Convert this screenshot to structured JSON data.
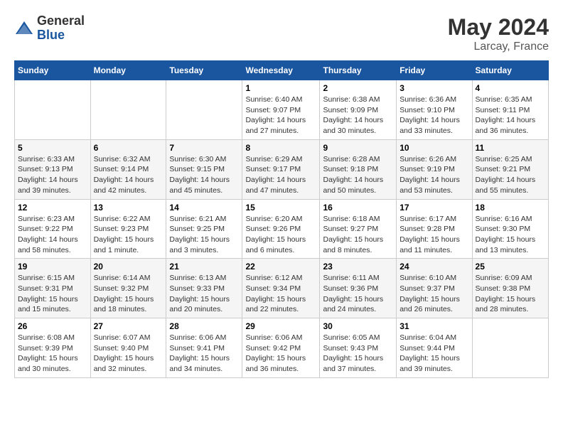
{
  "header": {
    "logo": {
      "general": "General",
      "blue": "Blue"
    },
    "title": "May 2024",
    "location": "Larcay, France"
  },
  "days_of_week": [
    "Sunday",
    "Monday",
    "Tuesday",
    "Wednesday",
    "Thursday",
    "Friday",
    "Saturday"
  ],
  "weeks": [
    [
      {
        "day": "",
        "info": ""
      },
      {
        "day": "",
        "info": ""
      },
      {
        "day": "",
        "info": ""
      },
      {
        "day": "1",
        "info": "Sunrise: 6:40 AM\nSunset: 9:07 PM\nDaylight: 14 hours\nand 27 minutes."
      },
      {
        "day": "2",
        "info": "Sunrise: 6:38 AM\nSunset: 9:09 PM\nDaylight: 14 hours\nand 30 minutes."
      },
      {
        "day": "3",
        "info": "Sunrise: 6:36 AM\nSunset: 9:10 PM\nDaylight: 14 hours\nand 33 minutes."
      },
      {
        "day": "4",
        "info": "Sunrise: 6:35 AM\nSunset: 9:11 PM\nDaylight: 14 hours\nand 36 minutes."
      }
    ],
    [
      {
        "day": "5",
        "info": "Sunrise: 6:33 AM\nSunset: 9:13 PM\nDaylight: 14 hours\nand 39 minutes."
      },
      {
        "day": "6",
        "info": "Sunrise: 6:32 AM\nSunset: 9:14 PM\nDaylight: 14 hours\nand 42 minutes."
      },
      {
        "day": "7",
        "info": "Sunrise: 6:30 AM\nSunset: 9:15 PM\nDaylight: 14 hours\nand 45 minutes."
      },
      {
        "day": "8",
        "info": "Sunrise: 6:29 AM\nSunset: 9:17 PM\nDaylight: 14 hours\nand 47 minutes."
      },
      {
        "day": "9",
        "info": "Sunrise: 6:28 AM\nSunset: 9:18 PM\nDaylight: 14 hours\nand 50 minutes."
      },
      {
        "day": "10",
        "info": "Sunrise: 6:26 AM\nSunset: 9:19 PM\nDaylight: 14 hours\nand 53 minutes."
      },
      {
        "day": "11",
        "info": "Sunrise: 6:25 AM\nSunset: 9:21 PM\nDaylight: 14 hours\nand 55 minutes."
      }
    ],
    [
      {
        "day": "12",
        "info": "Sunrise: 6:23 AM\nSunset: 9:22 PM\nDaylight: 14 hours\nand 58 minutes."
      },
      {
        "day": "13",
        "info": "Sunrise: 6:22 AM\nSunset: 9:23 PM\nDaylight: 15 hours\nand 1 minute."
      },
      {
        "day": "14",
        "info": "Sunrise: 6:21 AM\nSunset: 9:25 PM\nDaylight: 15 hours\nand 3 minutes."
      },
      {
        "day": "15",
        "info": "Sunrise: 6:20 AM\nSunset: 9:26 PM\nDaylight: 15 hours\nand 6 minutes."
      },
      {
        "day": "16",
        "info": "Sunrise: 6:18 AM\nSunset: 9:27 PM\nDaylight: 15 hours\nand 8 minutes."
      },
      {
        "day": "17",
        "info": "Sunrise: 6:17 AM\nSunset: 9:28 PM\nDaylight: 15 hours\nand 11 minutes."
      },
      {
        "day": "18",
        "info": "Sunrise: 6:16 AM\nSunset: 9:30 PM\nDaylight: 15 hours\nand 13 minutes."
      }
    ],
    [
      {
        "day": "19",
        "info": "Sunrise: 6:15 AM\nSunset: 9:31 PM\nDaylight: 15 hours\nand 15 minutes."
      },
      {
        "day": "20",
        "info": "Sunrise: 6:14 AM\nSunset: 9:32 PM\nDaylight: 15 hours\nand 18 minutes."
      },
      {
        "day": "21",
        "info": "Sunrise: 6:13 AM\nSunset: 9:33 PM\nDaylight: 15 hours\nand 20 minutes."
      },
      {
        "day": "22",
        "info": "Sunrise: 6:12 AM\nSunset: 9:34 PM\nDaylight: 15 hours\nand 22 minutes."
      },
      {
        "day": "23",
        "info": "Sunrise: 6:11 AM\nSunset: 9:36 PM\nDaylight: 15 hours\nand 24 minutes."
      },
      {
        "day": "24",
        "info": "Sunrise: 6:10 AM\nSunset: 9:37 PM\nDaylight: 15 hours\nand 26 minutes."
      },
      {
        "day": "25",
        "info": "Sunrise: 6:09 AM\nSunset: 9:38 PM\nDaylight: 15 hours\nand 28 minutes."
      }
    ],
    [
      {
        "day": "26",
        "info": "Sunrise: 6:08 AM\nSunset: 9:39 PM\nDaylight: 15 hours\nand 30 minutes."
      },
      {
        "day": "27",
        "info": "Sunrise: 6:07 AM\nSunset: 9:40 PM\nDaylight: 15 hours\nand 32 minutes."
      },
      {
        "day": "28",
        "info": "Sunrise: 6:06 AM\nSunset: 9:41 PM\nDaylight: 15 hours\nand 34 minutes."
      },
      {
        "day": "29",
        "info": "Sunrise: 6:06 AM\nSunset: 9:42 PM\nDaylight: 15 hours\nand 36 minutes."
      },
      {
        "day": "30",
        "info": "Sunrise: 6:05 AM\nSunset: 9:43 PM\nDaylight: 15 hours\nand 37 minutes."
      },
      {
        "day": "31",
        "info": "Sunrise: 6:04 AM\nSunset: 9:44 PM\nDaylight: 15 hours\nand 39 minutes."
      },
      {
        "day": "",
        "info": ""
      }
    ]
  ]
}
